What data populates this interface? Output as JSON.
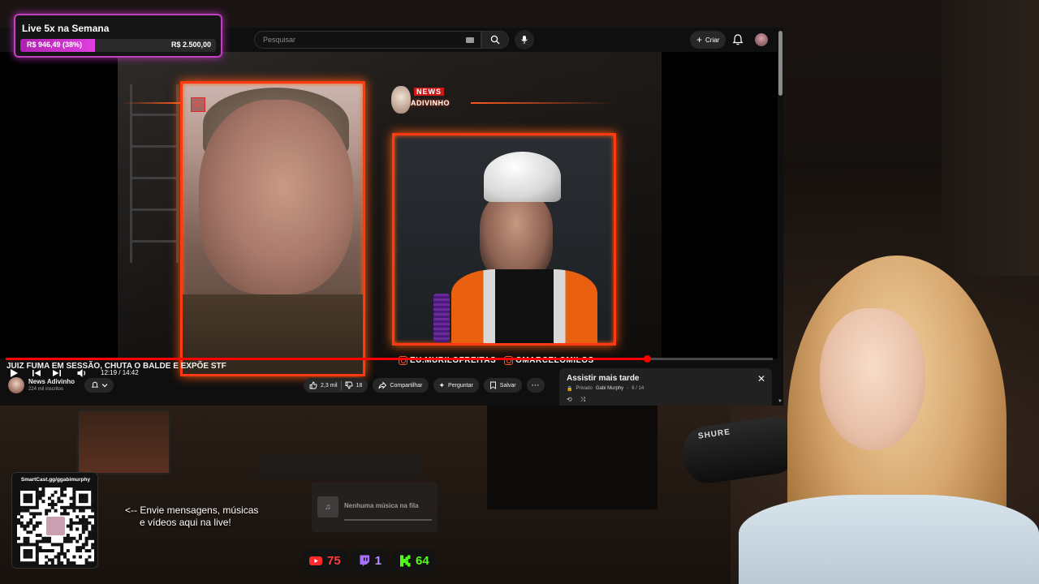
{
  "goal_widget": {
    "title": "Live 5x na Semana",
    "current": "R$ 946,49 (38%)",
    "target": "R$ 2.500,00",
    "progress_fraction": 0.38,
    "accent_color": "#c040c0"
  },
  "youtube": {
    "search_placeholder": "Pesquisar",
    "create_label": "Criar",
    "icons": {
      "search": "search-icon",
      "mic": "mic-icon",
      "bell": "bell-icon",
      "menu": "menu-icon"
    },
    "video": {
      "logo_top": "NEWS",
      "logo_bottom": "ADIVINHO",
      "handle_1": "EU.MURILOFREITAS",
      "handle_2": "OMARCELOMILOS",
      "time": "12:19 / 14:42",
      "progress_fraction": 0.836
    },
    "title": "JUIZ FUMA EM SESSÃO, CHUTA O BALDE E EXPÕE STF",
    "channel": {
      "name": "News Adivinho",
      "subscribers": "224 mil inscritos"
    },
    "actions": {
      "likes": "2,3 mil",
      "dislikes": "18",
      "share": "Compartilhar",
      "ask": "Perguntar",
      "save": "Salvar"
    },
    "watch_later": {
      "title": "Assistir mais tarde",
      "privacy": "Privado",
      "owner": "Gabi Murphy",
      "position": "6 / 14"
    }
  },
  "qr": {
    "url": "SmartCast.gg/ggabimurphy"
  },
  "send_message": {
    "line1": "<-- Envie mensagens, músicas",
    "line2": "e vídeos aqui na live!"
  },
  "music_queue": {
    "empty_text": "Nenhuma música na fila"
  },
  "viewers": {
    "youtube": "75",
    "twitch": "1",
    "kick": "64",
    "colors": {
      "youtube": "#ff3333",
      "twitch": "#a970ff",
      "kick": "#53fc18"
    }
  },
  "microphone_brand": "SHURE"
}
